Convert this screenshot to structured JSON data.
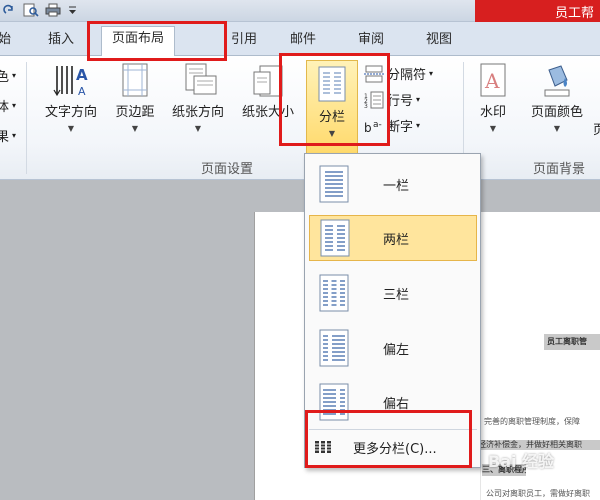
{
  "title_bar": {
    "title": "员工帮"
  },
  "tabs": [
    {
      "label": "始"
    },
    {
      "label": "插入"
    },
    {
      "label": "页面布局",
      "active": true
    },
    {
      "label": "引用"
    },
    {
      "label": "邮件"
    },
    {
      "label": "审阅"
    },
    {
      "label": "视图"
    }
  ],
  "ribbon": {
    "left_cut": [
      "色",
      "体",
      "果"
    ],
    "page_setup": {
      "group_label": "页面设置",
      "text_direction": "文字方向",
      "margins": "页边距",
      "orientation": "纸张方向",
      "size": "纸张大小",
      "columns": "分栏",
      "breaks": "分隔符",
      "line_numbers": "行号",
      "hyphenation": "断字"
    },
    "page_background": {
      "group_label": "页面背景",
      "watermark": "水印",
      "page_color": "页面颜色",
      "page_border_cut": "页"
    }
  },
  "columns_menu": {
    "items": [
      {
        "label": "一栏",
        "icon": "one-column-icon"
      },
      {
        "label": "两栏",
        "icon": "two-columns-icon",
        "selected": true
      },
      {
        "label": "三栏",
        "icon": "three-columns-icon"
      },
      {
        "label": "偏左",
        "icon": "left-column-icon"
      },
      {
        "label": "偏右",
        "icon": "right-column-icon"
      }
    ],
    "more": "更多分栏(C)..."
  },
  "document": {
    "heading": "员工离职管",
    "line1": "完善的离职管理制度，保障",
    "line2": "经济补偿金，并做好相关离职",
    "line3": "三、离职程序",
    "line4": "公司对离职员工，需做好离职"
  },
  "watermark": "Bai 经验"
}
